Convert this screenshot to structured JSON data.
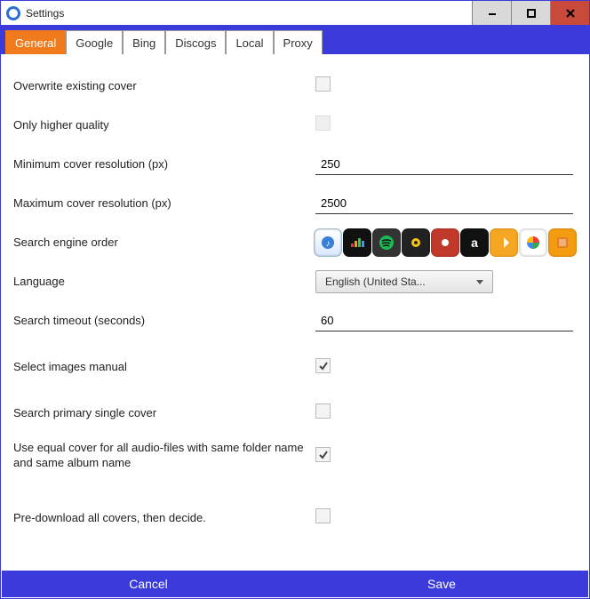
{
  "window": {
    "title": "Settings"
  },
  "tabs": [
    "General",
    "Google",
    "Bing",
    "Discogs",
    "Local",
    "Proxy"
  ],
  "active_tab": 0,
  "fields": {
    "overwrite_label": "Overwrite existing cover",
    "overwrite_checked": false,
    "higher_quality_label": "Only higher quality",
    "higher_quality_checked": false,
    "higher_quality_disabled": true,
    "min_res_label": "Minimum cover resolution (px)",
    "min_res_value": "250",
    "max_res_label": "Maximum cover resolution (px)",
    "max_res_value": "2500",
    "engine_order_label": "Search engine order",
    "language_label": "Language",
    "language_value": "English (United Sta...",
    "timeout_label": "Search timeout (seconds)",
    "timeout_value": "60",
    "select_manual_label": "Select images manual",
    "select_manual_checked": true,
    "primary_single_label": "Search primary single cover",
    "primary_single_checked": false,
    "equal_cover_label": "Use equal cover for all audio-files with same folder name and same album name",
    "equal_cover_checked": true,
    "predownload_label": "Pre-download all covers, then decide.",
    "predownload_checked": false
  },
  "engines": [
    "itunes",
    "deezer",
    "spotify",
    "discogs",
    "gracenote",
    "amazon",
    "bing",
    "google",
    "bookstore"
  ],
  "buttons": {
    "cancel": "Cancel",
    "save": "Save"
  }
}
